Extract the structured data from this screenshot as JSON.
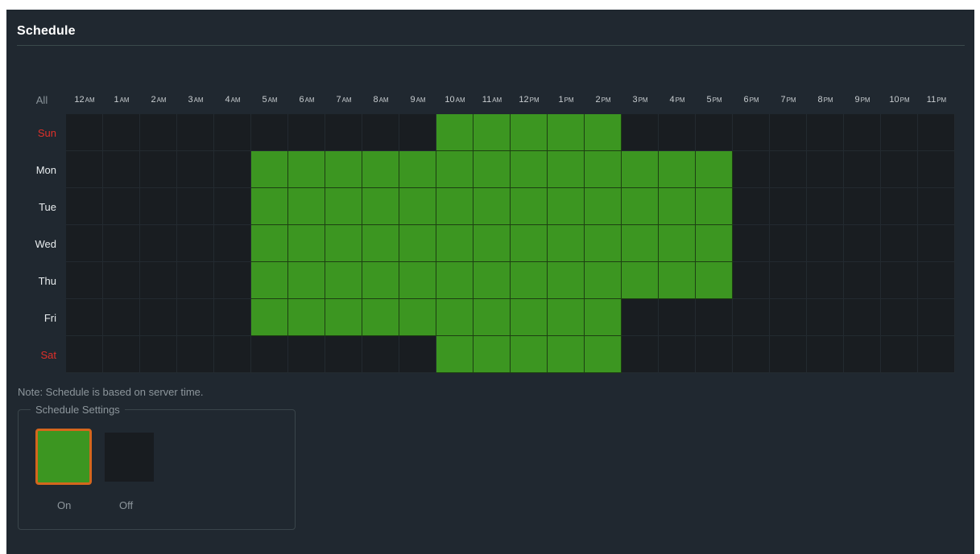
{
  "title": "Schedule",
  "grid": {
    "all_label": "All",
    "hours": [
      {
        "n": "12",
        "s": "AM"
      },
      {
        "n": "1",
        "s": "AM"
      },
      {
        "n": "2",
        "s": "AM"
      },
      {
        "n": "3",
        "s": "AM"
      },
      {
        "n": "4",
        "s": "AM"
      },
      {
        "n": "5",
        "s": "AM"
      },
      {
        "n": "6",
        "s": "AM"
      },
      {
        "n": "7",
        "s": "AM"
      },
      {
        "n": "8",
        "s": "AM"
      },
      {
        "n": "9",
        "s": "AM"
      },
      {
        "n": "10",
        "s": "AM"
      },
      {
        "n": "11",
        "s": "AM"
      },
      {
        "n": "12",
        "s": "PM"
      },
      {
        "n": "1",
        "s": "PM"
      },
      {
        "n": "2",
        "s": "PM"
      },
      {
        "n": "3",
        "s": "PM"
      },
      {
        "n": "4",
        "s": "PM"
      },
      {
        "n": "5",
        "s": "PM"
      },
      {
        "n": "6",
        "s": "PM"
      },
      {
        "n": "7",
        "s": "PM"
      },
      {
        "n": "8",
        "s": "PM"
      },
      {
        "n": "9",
        "s": "PM"
      },
      {
        "n": "10",
        "s": "PM"
      },
      {
        "n": "11",
        "s": "PM"
      }
    ],
    "days": [
      {
        "label": "Sun",
        "color": "#e0302a",
        "on_hours": [
          10,
          11,
          12,
          13,
          14
        ]
      },
      {
        "label": "Mon",
        "color": "#e8ecee",
        "on_hours": [
          5,
          6,
          7,
          8,
          9,
          10,
          11,
          12,
          13,
          14,
          15,
          16,
          17
        ]
      },
      {
        "label": "Tue",
        "color": "#e8ecee",
        "on_hours": [
          5,
          6,
          7,
          8,
          9,
          10,
          11,
          12,
          13,
          14,
          15,
          16,
          17
        ]
      },
      {
        "label": "Wed",
        "color": "#e8ecee",
        "on_hours": [
          5,
          6,
          7,
          8,
          9,
          10,
          11,
          12,
          13,
          14,
          15,
          16,
          17
        ]
      },
      {
        "label": "Thu",
        "color": "#e8ecee",
        "on_hours": [
          5,
          6,
          7,
          8,
          9,
          10,
          11,
          12,
          13,
          14,
          15,
          16,
          17
        ]
      },
      {
        "label": "Fri",
        "color": "#e8ecee",
        "on_hours": [
          5,
          6,
          7,
          8,
          9,
          10,
          11,
          12,
          13,
          14
        ]
      },
      {
        "label": "Sat",
        "color": "#e0302a",
        "on_hours": [
          10,
          11,
          12,
          13,
          14
        ]
      }
    ]
  },
  "note": "Note: Schedule is based on server time.",
  "settings": {
    "legend": "Schedule Settings",
    "on_label": "On",
    "off_label": "Off",
    "selected": "On"
  },
  "colors": {
    "on": "#3c9621",
    "off": "#181c20",
    "selected_border": "#d4661d",
    "weekend_label": "#e0302a",
    "panel": "#202830"
  }
}
